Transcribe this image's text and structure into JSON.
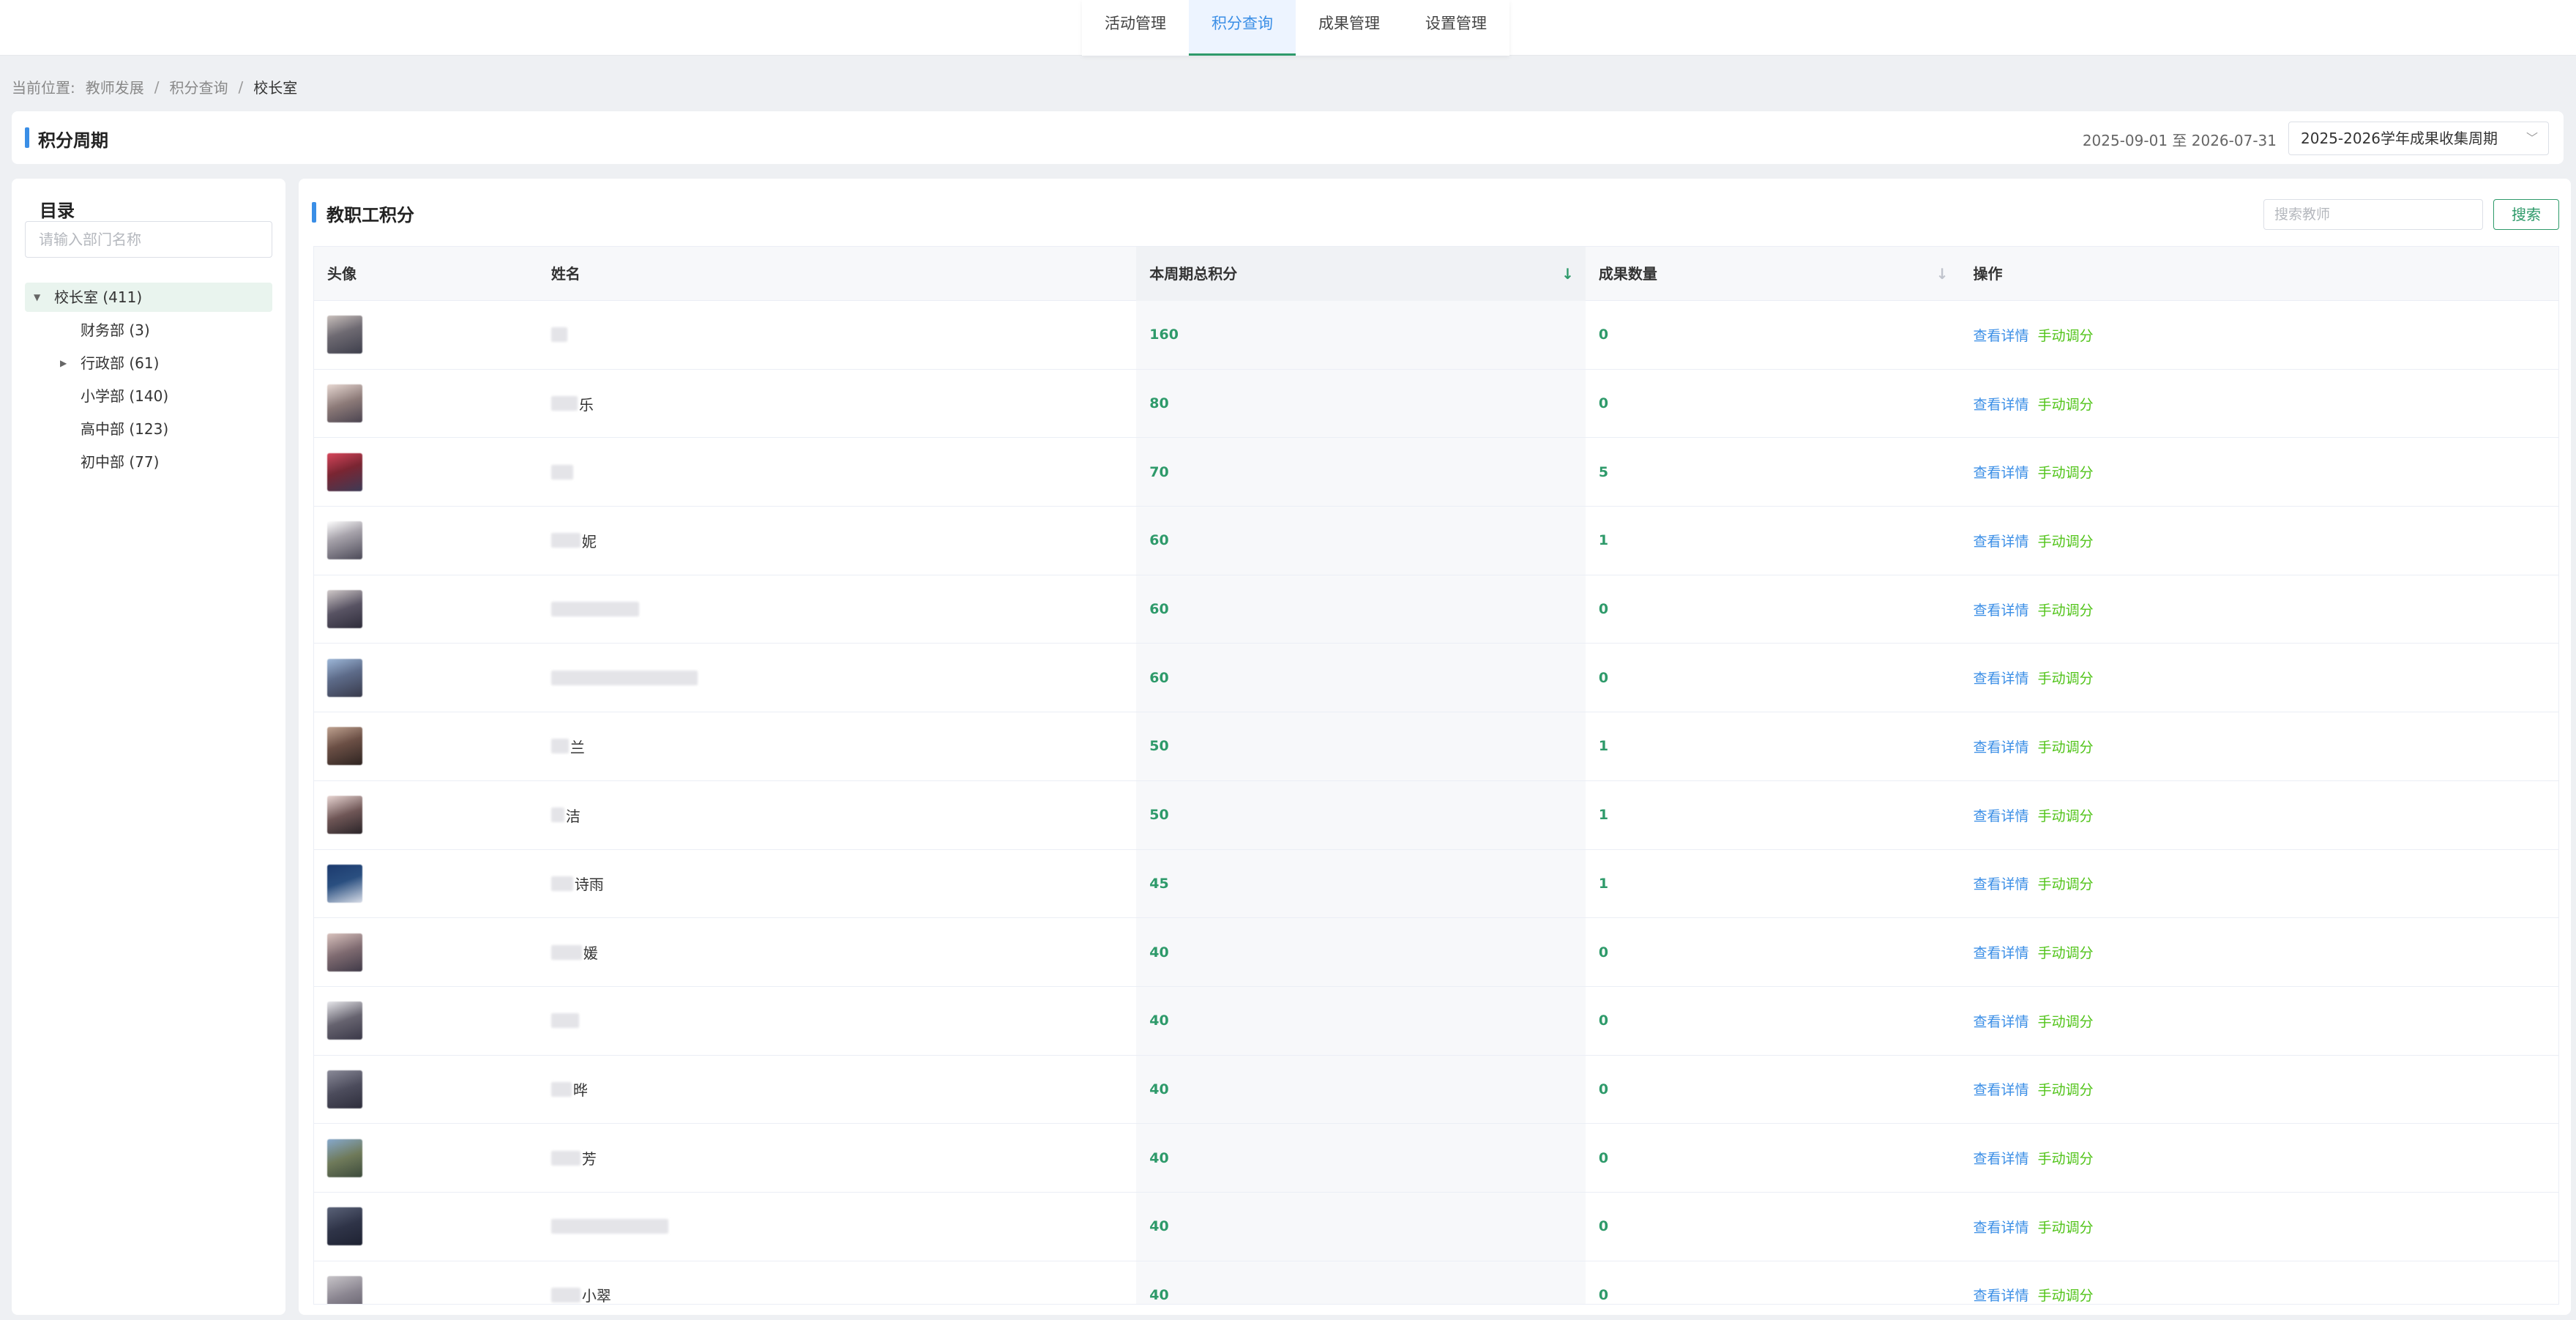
{
  "nav": {
    "tabs": [
      {
        "label": "活动管理",
        "active": false
      },
      {
        "label": "积分查询",
        "active": true
      },
      {
        "label": "成果管理",
        "active": false
      },
      {
        "label": "设置管理",
        "active": false
      }
    ]
  },
  "breadcrumb": {
    "prefix": "当前位置:",
    "items": [
      "教师发展",
      "积分查询",
      "校长室"
    ],
    "separator": "/"
  },
  "period": {
    "title": "积分周期",
    "range": "2025-09-01 至 2026-07-31",
    "selected": "2025-2026学年成果收集周期"
  },
  "directory": {
    "title": "目录",
    "search_placeholder": "请输入部门名称",
    "root": {
      "label": "校长室 (411)",
      "expanded": true
    },
    "children": [
      {
        "label": "财务部 (3)",
        "has_children": false
      },
      {
        "label": "行政部 (61)",
        "has_children": true
      },
      {
        "label": "小学部 (140)",
        "has_children": false
      },
      {
        "label": "高中部 (123)",
        "has_children": false
      },
      {
        "label": "初中部 (77)",
        "has_children": false
      }
    ]
  },
  "main": {
    "title": "教职工积分",
    "search_placeholder": "搜索教师",
    "search_button": "搜索",
    "columns": {
      "avatar": "头像",
      "name": "姓名",
      "total_score": "本周期总积分",
      "achievement_count": "成果数量",
      "actions": "操作"
    },
    "action_labels": {
      "detail": "查看详情",
      "adjust": "手动调分"
    },
    "rows": [
      {
        "name_visible": "",
        "score": "160",
        "count": "0"
      },
      {
        "name_visible": "乐",
        "score": "80",
        "count": "0"
      },
      {
        "name_visible": "",
        "score": "70",
        "count": "5"
      },
      {
        "name_visible": "妮",
        "score": "60",
        "count": "1"
      },
      {
        "name_visible": "",
        "score": "60",
        "count": "0"
      },
      {
        "name_visible": "",
        "score": "60",
        "count": "0"
      },
      {
        "name_visible": "兰",
        "score": "50",
        "count": "1"
      },
      {
        "name_visible": "洁",
        "score": "50",
        "count": "1"
      },
      {
        "name_visible": "诗雨",
        "score": "45",
        "count": "1"
      },
      {
        "name_visible": "媛",
        "score": "40",
        "count": "0"
      },
      {
        "name_visible": "",
        "score": "40",
        "count": "0"
      },
      {
        "name_visible": "晔",
        "score": "40",
        "count": "0"
      },
      {
        "name_visible": "芳",
        "score": "40",
        "count": "0"
      },
      {
        "name_visible": "",
        "score": "40",
        "count": "0"
      },
      {
        "name_visible": "小翠",
        "score": "40",
        "count": "0"
      }
    ]
  }
}
